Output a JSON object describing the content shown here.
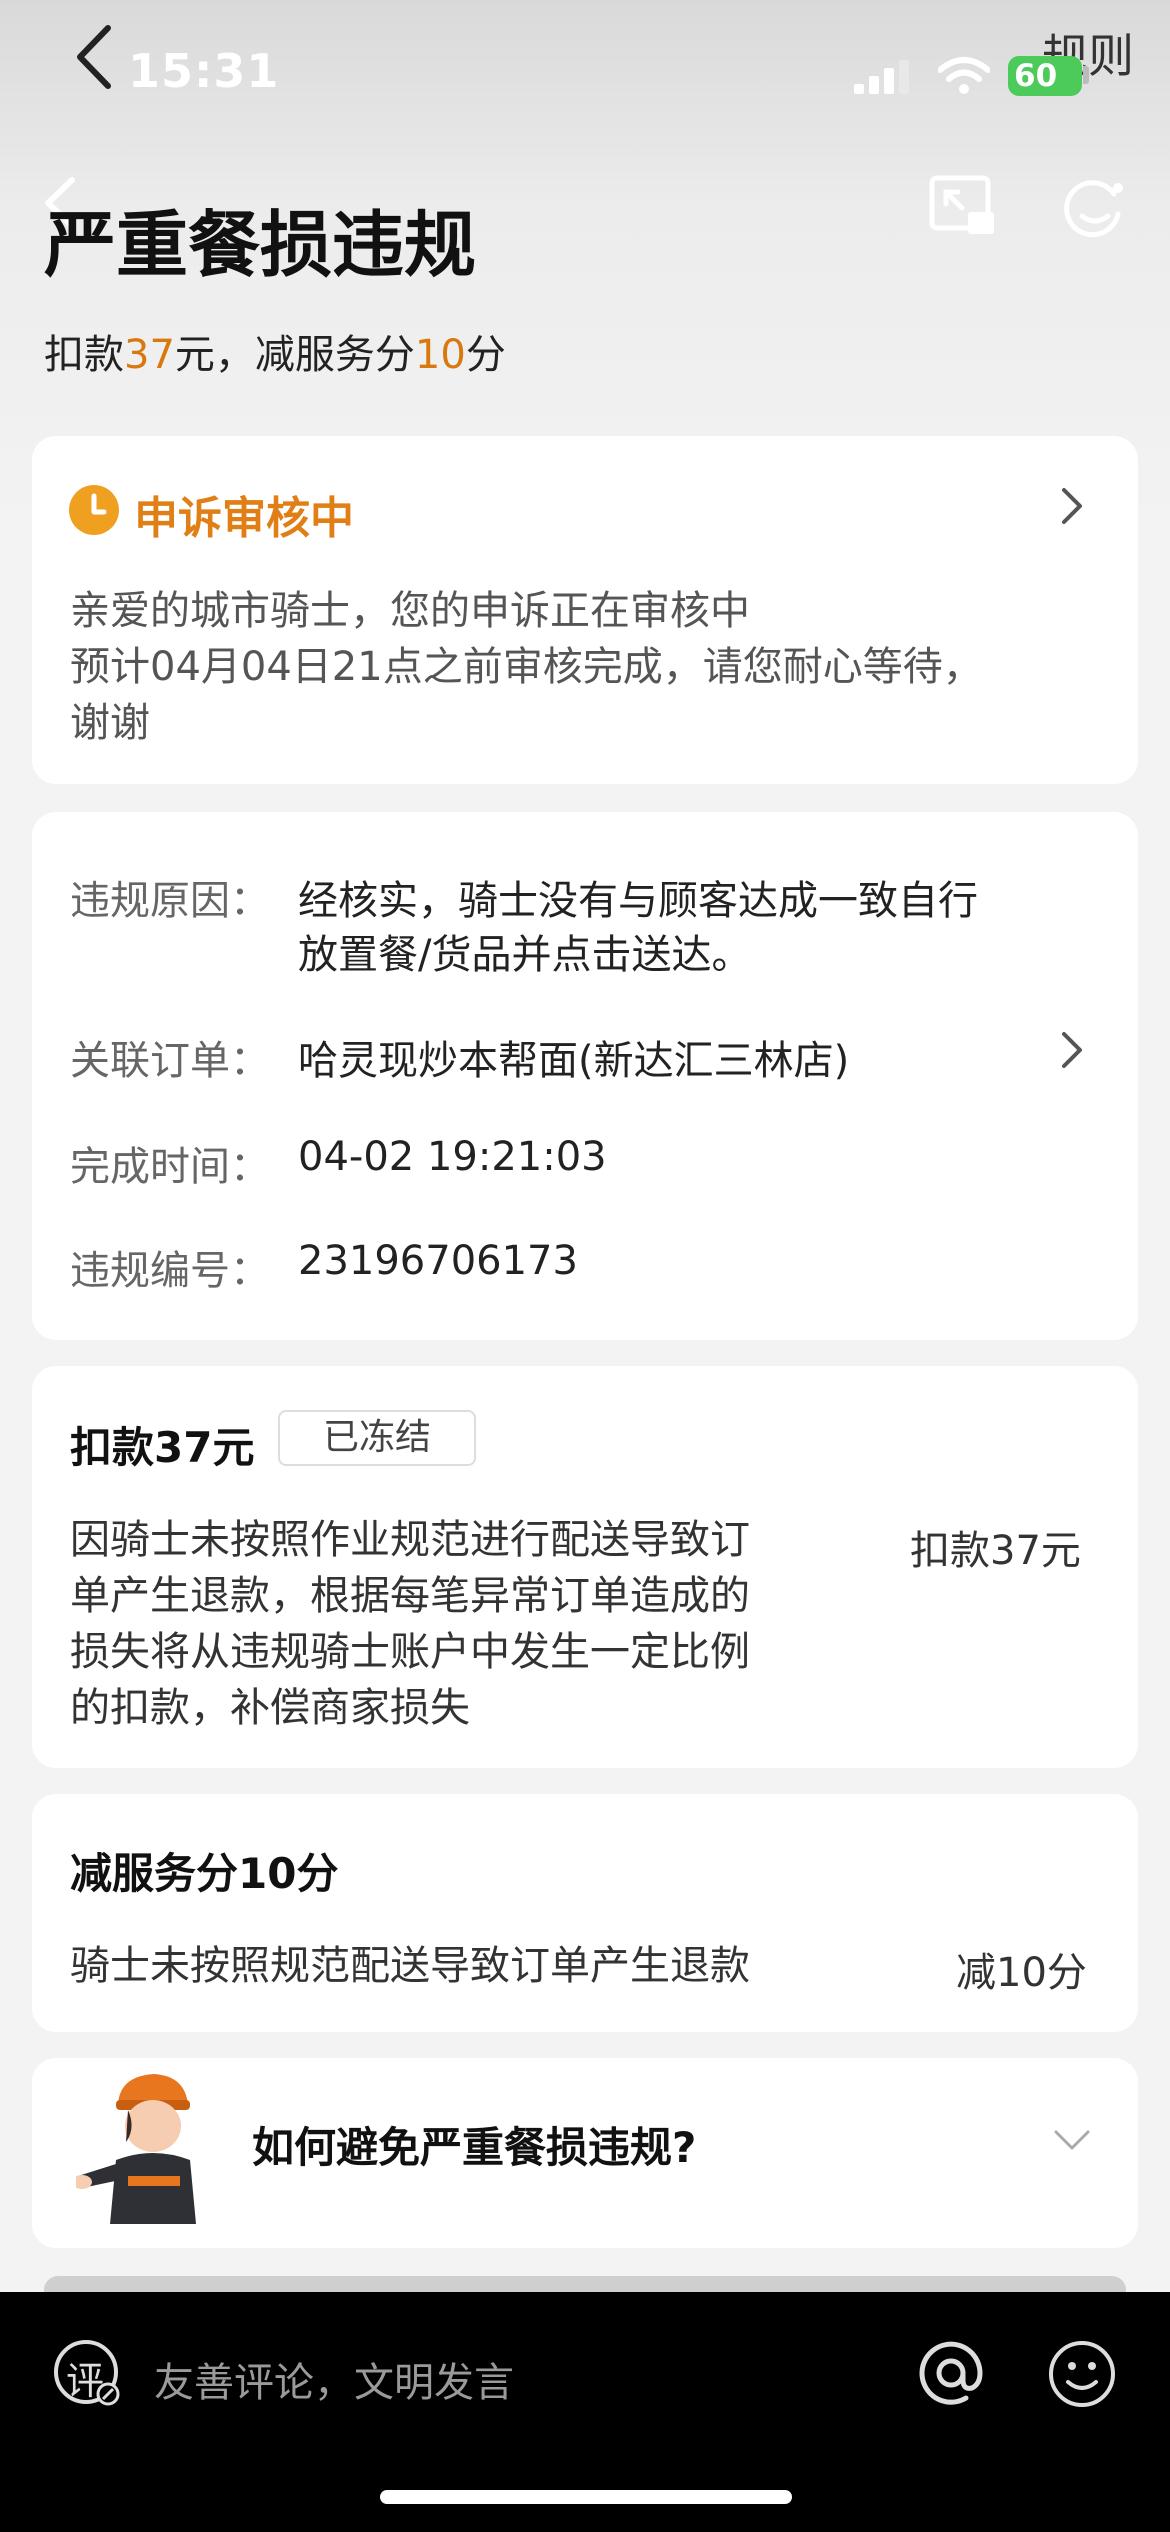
{
  "status_bar": {
    "time": "15:31",
    "battery": "60"
  },
  "top_right_link": "规则",
  "header": {
    "title": "严重餐损违规",
    "subtitle_prefix": "扣款",
    "fine_amount": "37",
    "subtitle_mid": "元，减服务分",
    "score_amount": "10",
    "subtitle_suffix": "分"
  },
  "appeal": {
    "title": "申诉审核中",
    "line1": "亲爱的城市骑士，您的申诉正在审核中",
    "line2": "预计04月04日21点之前审核完成，请您耐心等待，",
    "line3": "谢谢"
  },
  "details": {
    "reason_label": "违规原因：",
    "reason_line1": "经核实，骑士没有与顾客达成一致自行",
    "reason_line2": "放置餐/货品并点击送达。",
    "order_label": "关联订单：",
    "order_value": "哈灵现炒本帮面(新达汇三林店)",
    "time_label": "完成时间：",
    "time_value": "04-02 19:21:03",
    "id_label": "违规编号：",
    "id_value": "23196706173"
  },
  "deduction": {
    "title": "扣款37元",
    "badge": "已冻结",
    "lines": [
      "因骑士未按照作业规范进行配送导致订",
      "单产生退款，根据每笔异常订单造成的",
      "损失将从违规骑士账户中发生一定比例",
      "的扣款，补偿商家损失"
    ],
    "amount": "扣款37元"
  },
  "score": {
    "title": "减服务分10分",
    "desc": "骑士未按照规范配送导致订单产生退款",
    "amount": "减10分"
  },
  "faq": {
    "title": "如何避免严重餐损违规?"
  },
  "comment": {
    "placeholder": "友善评论，文明发言",
    "icon_text": "评"
  },
  "colors": {
    "accent_orange": "#e07f16",
    "battery_green": "#4ccb5a"
  }
}
